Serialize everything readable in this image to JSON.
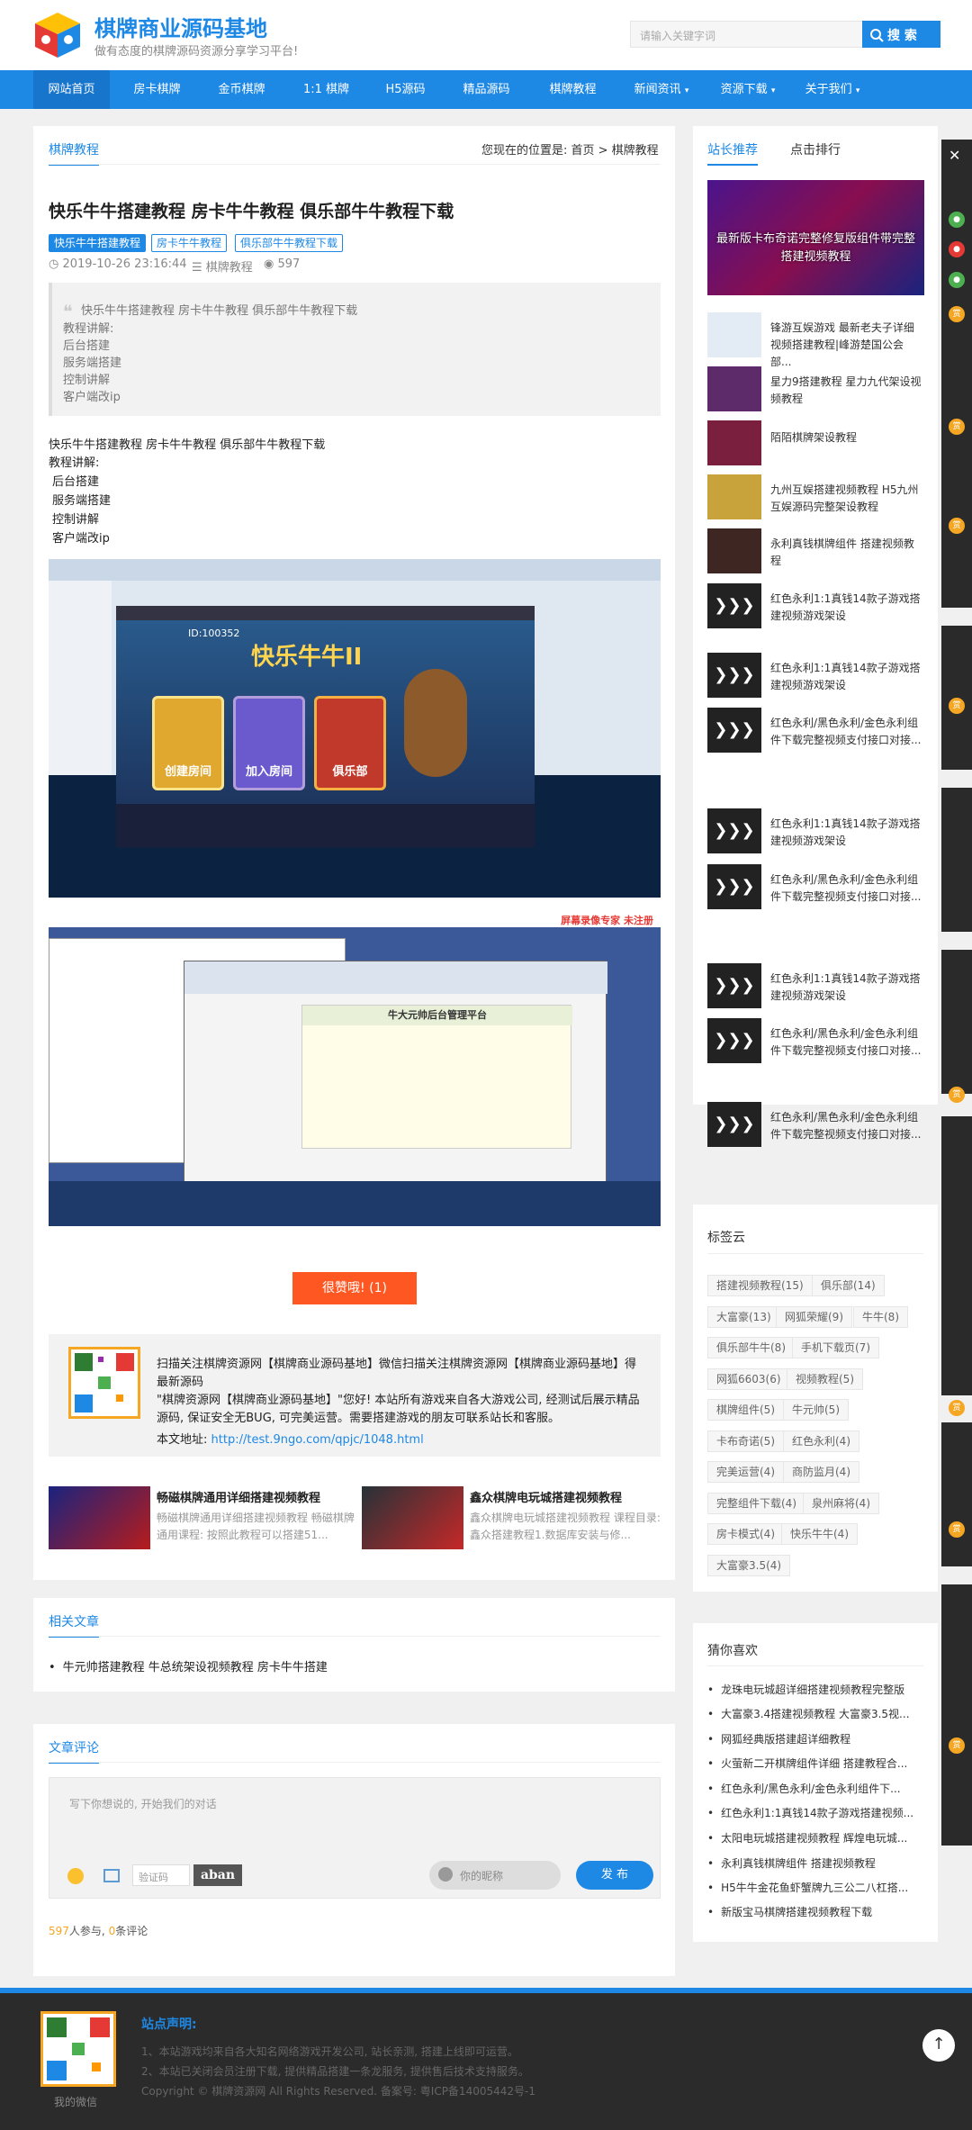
{
  "header": {
    "site_title": "棋牌商业源码基地",
    "site_subtitle": "做有态度的棋牌源码资源分享学习平台!",
    "search_placeholder": "请输入关键字词",
    "search_button": "搜 索"
  },
  "nav": [
    "网站首页",
    "房卡棋牌",
    "金币棋牌",
    "1:1 棋牌",
    "H5源码",
    "精品源码",
    "棋牌教程",
    "新闻资讯",
    "资源下载",
    "关于我们"
  ],
  "article": {
    "category": "棋牌教程",
    "breadcrumb": "您现在的位置是: 首页 > 棋牌教程",
    "title": "快乐牛牛搭建教程 房卡牛牛教程 俱乐部牛牛教程下载",
    "tags": [
      "快乐牛牛搭建教程",
      "房卡牛牛教程",
      "俱乐部牛牛教程下载"
    ],
    "date": "2019-10-26 23:16:44",
    "meta_category": "棋牌教程",
    "views": "597",
    "summary": [
      "快乐牛牛搭建教程 房卡牛牛教程 俱乐部牛牛教程下载",
      "教程讲解:",
      "后台搭建",
      "服务端搭建",
      "控制讲解",
      "客户端改ip"
    ],
    "body": [
      "快乐牛牛搭建教程 房卡牛牛教程 俱乐部牛牛教程下载",
      "教程讲解:",
      "后台搭建",
      "服务端搭建",
      "控制讲解",
      "客户端改ip"
    ],
    "like_button": "很赞哦! (1)",
    "ad": {
      "line1": "扫描关注棋牌资源网【棋牌商业源码基地】微信扫描关注棋牌资源网【棋牌商业源码基地】得最新源码",
      "line2": "\"棋牌资源网【棋牌商业源码基地】\"您好! 本站所有游戏来自各大游戏公司, 经测试后展示精品源码, 保证安全无BUG, 可完美运营。需要搭建游戏的朋友可联系站长和客服。",
      "addr_label": "本文地址:",
      "addr_url": "http://test.9ngo.com/qpjc/1048.html"
    },
    "related_cards": [
      {
        "title": "畅磁棋牌通用详细搭建视频教程",
        "desc": "畅磁棋牌通用详细搭建视频教程 畅磁棋牌通用课程: 按照此教程可以搭建51..."
      },
      {
        "title": "鑫众棋牌电玩城搭建视频教程",
        "desc": "鑫众棋牌电玩城搭建视频教程 课程目录: 鑫众搭建教程1.数据库安装与修..."
      }
    ]
  },
  "related": {
    "title": "相关文章",
    "items": [
      "牛元帅搭建教程 牛总统架设视频教程 房卡牛牛搭建"
    ]
  },
  "comments": {
    "title": "文章评论",
    "placeholder": "写下你想说的, 开始我们的对话",
    "captcha_placeholder": "验证码",
    "captcha_text": "aban",
    "nickname_placeholder": "你的昵称",
    "submit": "发 布",
    "participants": "597",
    "participants_label": "人参与,",
    "count": "0",
    "count_label": "条评论"
  },
  "sidebar": {
    "tabs": [
      "站长推荐",
      "点击排行"
    ],
    "featured_caption": "最新版卡布奇诺完整修复版组件带完整搭建视频教程",
    "items": [
      "锋游互娱游戏 最新老夫子详细视频搭建教程|峰游楚国公会部...",
      "星力9搭建教程 星力九代架设视频教程",
      "陌陌棋牌架设教程",
      "九州互娱搭建视频教程 H5九州互娱源码完整架设教程",
      "永利真钱棋牌组件 搭建视频教程",
      "红色永利1:1真钱14款子游戏搭建视频游戏架设",
      "红色永利1:1真钱14款子游戏搭建视频游戏架设",
      "红色永利/黑色永利/金色永利组件下载完整视频支付接口对接...",
      "红色永利1:1真钱14款子游戏搭建视频游戏架设",
      "红色永利/黑色永利/金色永利组件下载完整视频支付接口对接...",
      "红色永利1:1真钱14款子游戏搭建视频游戏架设",
      "红色永利/黑色永利/金色永利组件下载完整视频支付接口对接...",
      "红色永利/黑色永利/金色永利组件下载完整视频支付接口对接..."
    ],
    "tagcloud_title": "标签云",
    "tagcloud": [
      "搭建视频教程(15)",
      "俱乐部(14)",
      "大富豪(13)",
      "网狐荣耀(9)",
      "牛牛(8)",
      "俱乐部牛牛(8)",
      "手机下载页(7)",
      "网狐6603(6)",
      "视频教程(5)",
      "棋牌组件(5)",
      "牛元帅(5)",
      "卡布奇诺(5)",
      "红色永利(4)",
      "完美运营(4)",
      "商防监月(4)",
      "完整组件下载(4)",
      "泉州麻将(4)",
      "房卡模式(4)",
      "快乐牛牛(4)",
      "大富豪3.5(4)"
    ],
    "guess_title": "猜你喜欢",
    "guess": [
      "龙珠电玩城超详细搭建视频教程完整版",
      "大富豪3.4搭建视频教程 大富豪3.5视...",
      "网狐经典版搭建超详细教程",
      "火萤新二开棋牌组件详细 搭建教程合...",
      "红色永利/黑色永利/金色永利组件下...",
      "红色永利1:1真钱14款子游戏搭建视频...",
      "太阳电玩城搭建视频教程 辉煌电玩城...",
      "永利真钱棋牌组件 搭建视频教程",
      "H5牛牛金花鱼虾蟹牌九三公二八杠搭...",
      "新版宝马棋牌搭建视频教程下载"
    ]
  },
  "footer": {
    "statement_title": "站点声明:",
    "line1": "1、本站游戏均来自各大知名网络游戏开发公司, 站长亲测, 搭建上线即可运营。",
    "line2": "2、本站已关闭会员注册下载, 提供精品搭建一条龙服务, 提供售后技术支持服务。",
    "copyright": "Copyright © 棋牌资源网 All Rights Reserved. 备案号: 粤ICP备14005442号-1",
    "qr_label": "我的微信"
  },
  "screenshots": {
    "game_title": "快乐牛牛II",
    "game_id": "ID:100352",
    "buttons": [
      "创建房间",
      "加入房间",
      "俱乐部"
    ],
    "admin_title": "牛大元帅后台管理平台",
    "recorder": "屏幕录像专家 未注册"
  },
  "colors": {
    "brand": "#1e88e5",
    "accent": "#ff5722",
    "footer": "#2b2b2b"
  }
}
